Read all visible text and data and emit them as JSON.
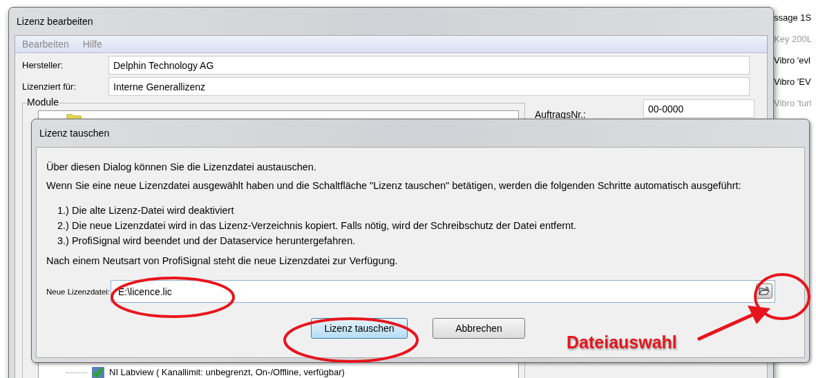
{
  "background_window": {
    "items": [
      {
        "label": "ssage 1S",
        "disabled": false
      },
      {
        "label": "Key 200L",
        "disabled": true
      },
      {
        "label": "Vibro 'evl",
        "disabled": false
      },
      {
        "label": "Vibro 'EV",
        "disabled": false
      },
      {
        "label": "Vibro 'turl",
        "disabled": true
      }
    ]
  },
  "edit_window": {
    "title": "Lizenz bearbeiten",
    "menu": [
      {
        "label": "Bearbeiten",
        "disabled": true
      },
      {
        "label": "Hilfe",
        "disabled": true
      }
    ],
    "fields": [
      {
        "label": "Hersteller:",
        "value": "Delphin Technology AG"
      },
      {
        "label": "Lizenziert für:",
        "value": "Interne Generallizenz"
      }
    ],
    "modules": {
      "title": "Module",
      "items": [
        {
          "label": "NI Labview ( Kanallimit: unbegrenzt, On-/Offline, verfügbar)",
          "checked": true
        }
      ]
    },
    "order_number": {
      "label": "AuftragsNr.:",
      "value": "00-0000"
    }
  },
  "dialog": {
    "title": "Lizenz tauschen",
    "intro": "Über diesen Dialog können Sie die Lizenzdatei austauschen.",
    "description": "Wenn Sie eine neue Lizenzdatei ausgewählt haben und die Schaltfläche \"Lizenz tauschen\" betätigen, werden die folgenden Schritte automatisch ausgeführt:",
    "steps": [
      "1.) Die alte Lizenz-Datei wird deaktiviert",
      "2.) Die neue Lizenzdatei wird in das Lizenz-Verzeichnis kopiert. Falls nötig, wird der Schreibschutz der Datei entfernt.",
      "3.) ProfiSignal wird beendet und der Dataservice heruntergefahren."
    ],
    "note": "Nach einem Neutsart von ProfiSignal steht die neue Lizenzdatei zur Verfügung.",
    "file_field": {
      "label": "Neue Lizenzdatei:",
      "value": "E:\\licence.lic"
    },
    "buttons": [
      {
        "label": "Lizenz tauschen",
        "default": true
      },
      {
        "label": "Abbrechen",
        "default": false
      }
    ]
  },
  "annotation": {
    "label": "Dateiauswahl"
  }
}
